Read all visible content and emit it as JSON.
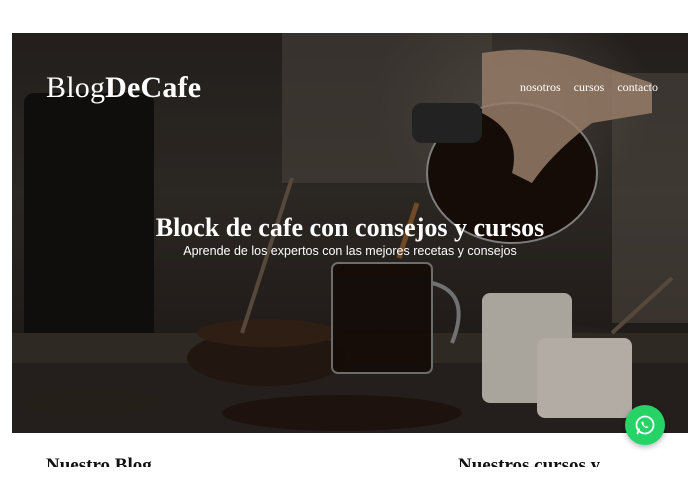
{
  "header": {
    "logo_part1": "Blog",
    "logo_part2": "DeCafe",
    "nav": [
      "nosotros",
      "cursos",
      "contacto"
    ]
  },
  "hero": {
    "title": "Block de cafe con consejos y cursos",
    "subtitle": "Aprende de los expertos con las mejores recetas y consejos"
  },
  "sections": {
    "blog_title": "Nuestro Blog",
    "courses_title": "Nuestros cursos y"
  },
  "floating": {
    "icon": "whatsapp-icon",
    "color": "#25d366"
  }
}
